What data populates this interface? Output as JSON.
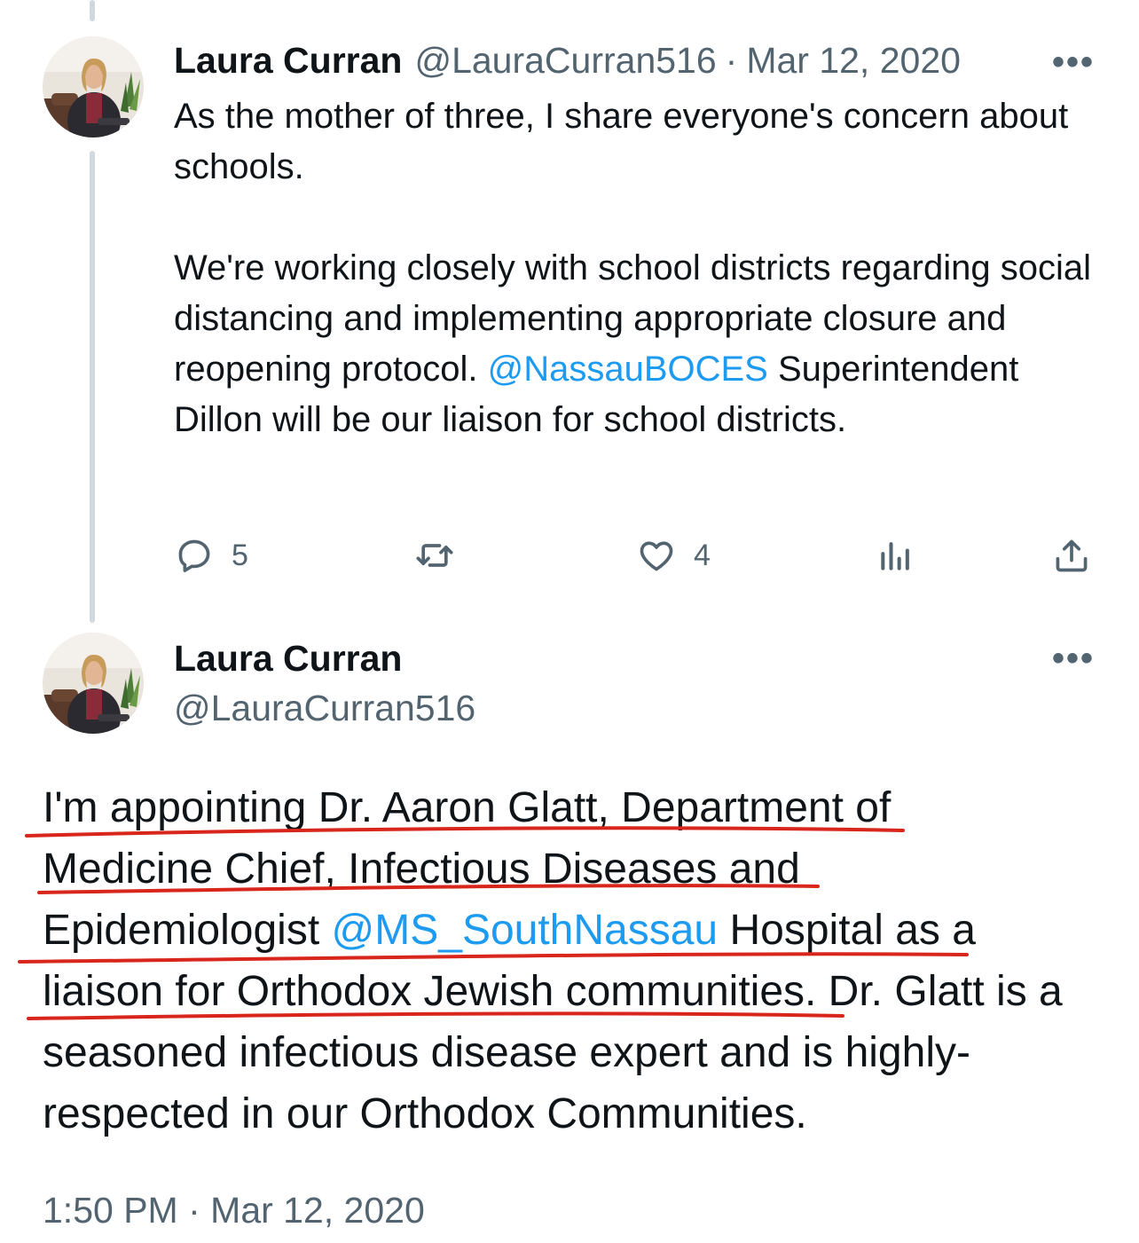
{
  "tweet1": {
    "author_name": "Laura Curran",
    "handle": "@LauraCurran516",
    "separator": "·",
    "date": "Mar 12, 2020",
    "text_p1": "As the mother of three, I share everyone's concern about schools.",
    "text_p2_before_mention": "We're working closely with school districts regarding social distancing and implementing appropriate closure and reopening protocol.",
    "mention": "@NassauBOCES",
    "text_p2_after_mention": "Superintendent Dillon will be our liaison for school districts.",
    "replies": "5",
    "likes": "4",
    "icons": [
      "reply-icon",
      "retweet-icon",
      "like-icon",
      "views-icon",
      "share-icon",
      "more-icon"
    ]
  },
  "tweet2": {
    "author_name": "Laura Curran",
    "handle": "@LauraCurran516",
    "lines": {
      "l1": "I'm appointing Dr. Aaron Glatt, Department of",
      "l2": "Medicine Chief, Infectious Diseases and",
      "l3_before_mention": "Epidemiologist",
      "mention": "@MS_SouthNassau",
      "l3_after_mention": "Hospital as a",
      "l4": "liaison for Orthodox Jewish communities. Dr. Glatt is a",
      "l5": "seasoned infectious disease expert and is highly-",
      "l6": "respected in our Orthodox Communities."
    },
    "time": "1:50 PM",
    "separator": "·",
    "date": "Mar 12, 2020"
  },
  "colors": {
    "text": "#0f1419",
    "muted": "#536471",
    "link": "#1d9bf0",
    "thread_line": "#cfd9de",
    "annotation_red": "#d8261c"
  },
  "more_glyph": "•••"
}
